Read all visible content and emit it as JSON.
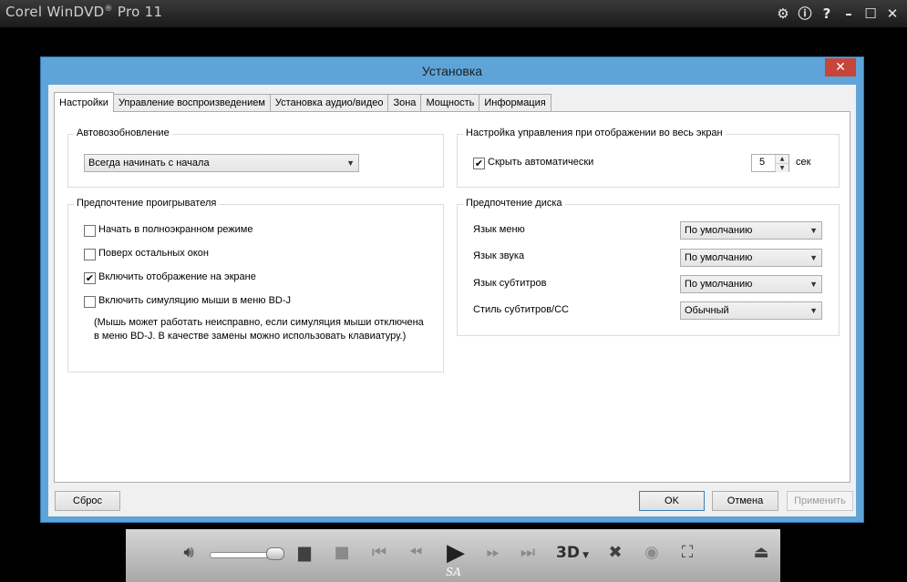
{
  "app": {
    "title": "Corel WinDVD",
    "title_reg": "®",
    "title_suffix": " Pro 11",
    "icons": [
      "gear-icon",
      "info-icon",
      "help-icon",
      "minimize-icon",
      "maximize-icon",
      "close-icon"
    ]
  },
  "dialog": {
    "title": "Установка",
    "close_glyph": "✕",
    "tabs": [
      "Настройки",
      "Управление воспроизведением",
      "Установка аудио/видео",
      "Зона",
      "Мощность",
      "Информация"
    ],
    "active_tab": 0,
    "autoresume": {
      "label": "Автовозобновление",
      "value": "Всегда начинать с начала"
    },
    "fullscreen": {
      "label": "Настройка управления при отображении во весь экран",
      "autohide_label": "Скрыть автоматически",
      "autohide_checked": true,
      "seconds_value": "5",
      "seconds_unit": "сек"
    },
    "player_pref": {
      "label": "Предпочтение проигрывателя",
      "options": [
        {
          "label": "Начать в полноэкранном режиме",
          "checked": false
        },
        {
          "label": "Поверх остальных окон",
          "checked": false
        },
        {
          "label": "Включить отображение на экране",
          "checked": true
        },
        {
          "label": "Включить симуляцию мыши в меню BD-J",
          "checked": false
        }
      ],
      "note_line1": "(Мышь может работать неисправно, если симуляция мыши отключена",
      "note_line2": "в меню BD-J. В качестве замены можно использовать клавиатуру.)"
    },
    "disc_pref": {
      "label": "Предпочтение диска",
      "rows": [
        {
          "label": "Язык меню",
          "value": "По умолчанию"
        },
        {
          "label": "Язык звука",
          "value": "По умолчанию"
        },
        {
          "label": "Язык субтитров",
          "value": "По умолчанию"
        },
        {
          "label": "Стиль субтитров/CC",
          "value": "Обычный"
        }
      ]
    },
    "buttons": {
      "reset": "Сброс",
      "ok": "OK",
      "cancel": "Отмена",
      "apply": "Применить"
    }
  },
  "player": {
    "volume_level": 0.75,
    "three_d_label": "3D",
    "sa_label": "SA"
  }
}
